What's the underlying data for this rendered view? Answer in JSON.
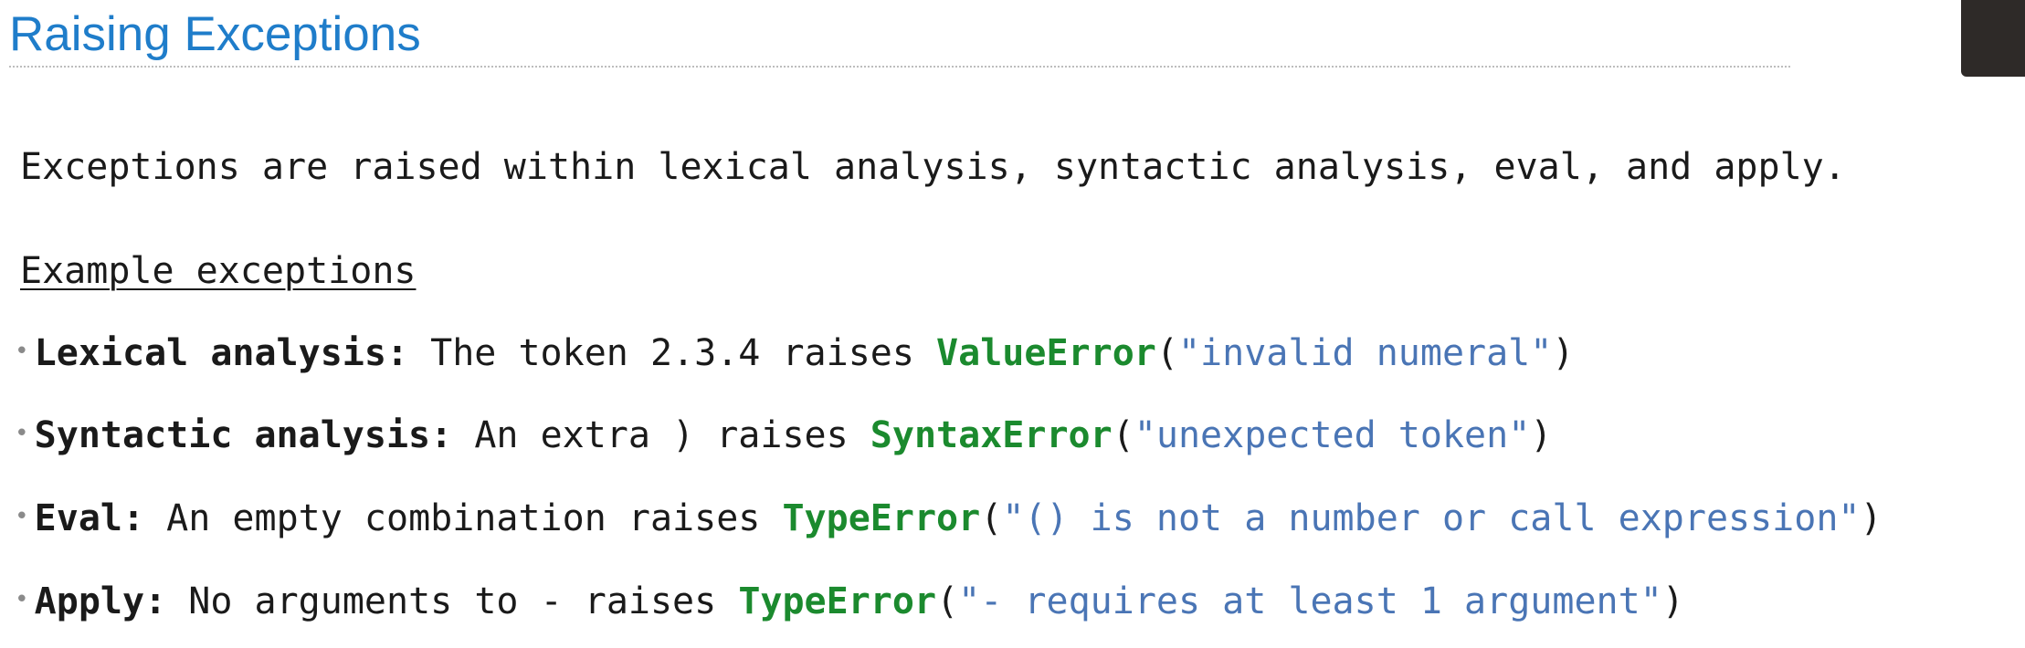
{
  "slide": {
    "title": "Raising Exceptions",
    "intro": "Exceptions are raised within lexical analysis, syntactic analysis, eval, and apply.",
    "subheading": "Example exceptions"
  },
  "items": [
    {
      "label": "Lexical analysis",
      "text": " The token 2.3.4 raises ",
      "error": "ValueError",
      "message": "\"invalid numeral\""
    },
    {
      "label": "Syntactic analysis",
      "text": " An extra ) raises ",
      "error": "SyntaxError",
      "message": "\"unexpected token\""
    },
    {
      "label": "Eval",
      "text": " An empty combination raises ",
      "error": "TypeError",
      "message": "\"() is not a number or call expression\""
    },
    {
      "label": "Apply",
      "text": " No arguments to - raises ",
      "error": "TypeError",
      "message": "\"- requires at least 1 argument\""
    }
  ],
  "colors": {
    "title": "#1f7dca",
    "error": "#1b8a2e",
    "string": "#4a75b5"
  }
}
